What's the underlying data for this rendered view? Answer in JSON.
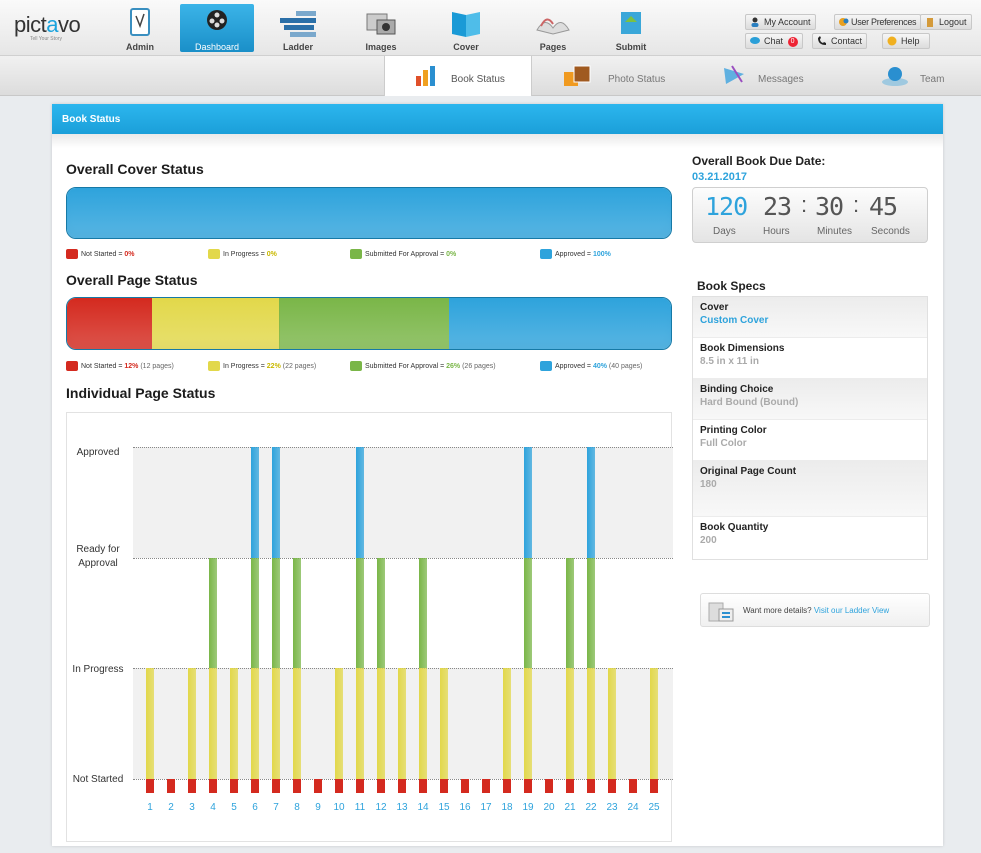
{
  "brand": {
    "name_pre": "pict",
    "name_o": "a",
    "name_post": "vo",
    "tagline": "Tell Your Story"
  },
  "nav": [
    {
      "label": "Admin",
      "icon": "clipboard-icon",
      "active": false
    },
    {
      "label": "Dashboard",
      "icon": "film-reel-icon",
      "active": true
    },
    {
      "label": "Ladder",
      "icon": "ladder-icon",
      "active": false
    },
    {
      "label": "Images",
      "icon": "images-icon",
      "active": false
    },
    {
      "label": "Cover",
      "icon": "book-cover-icon",
      "active": false
    },
    {
      "label": "Pages",
      "icon": "pages-icon",
      "active": false
    },
    {
      "label": "Submit",
      "icon": "submit-icon",
      "active": false
    }
  ],
  "account": {
    "my_account": "My Account",
    "user_preferences": "User Preferences",
    "logout": "Logout",
    "chat": "Chat",
    "chat_count": "0",
    "contact": "Contact",
    "help": "Help"
  },
  "subnav": [
    {
      "label": "Book Status",
      "icon": "bar-chart-icon",
      "active": true
    },
    {
      "label": "Photo Status",
      "icon": "photos-icon",
      "active": false
    },
    {
      "label": "Messages",
      "icon": "messages-icon",
      "active": false
    },
    {
      "label": "Team",
      "icon": "team-icon",
      "active": false
    }
  ],
  "panel": {
    "title": "Book Status"
  },
  "colors": {
    "not_started": "#d42a1f",
    "in_progress": "#e2d84a",
    "submitted": "#7ab648",
    "approved": "#2ea3dc"
  },
  "cover_status": {
    "title": "Overall Cover Status",
    "legend": [
      {
        "label": "Not Started = ",
        "pct": "0%",
        "pages": ""
      },
      {
        "label": "In Progress = ",
        "pct": "0%",
        "pages": ""
      },
      {
        "label": "Submitted For Approval = ",
        "pct": "0%",
        "pages": ""
      },
      {
        "label": "Approved = ",
        "pct": "100%",
        "pages": ""
      }
    ],
    "fractions": [
      0,
      0,
      0,
      1.0
    ]
  },
  "page_status": {
    "title": "Overall Page Status",
    "legend": [
      {
        "label": "Not Started = ",
        "pct": "12%",
        "pages": "(12 pages)"
      },
      {
        "label": "In Progress = ",
        "pct": "22%",
        "pages": "(22 pages)"
      },
      {
        "label": "Submitted For Approval = ",
        "pct": "26%",
        "pages": "(26 pages)"
      },
      {
        "label": "Approved = ",
        "pct": "40%",
        "pages": "(40 pages)"
      }
    ],
    "fractions": [
      0.14,
      0.21,
      0.28,
      0.37
    ]
  },
  "individual": {
    "title": "Individual Page Status",
    "levels": [
      "Not Started",
      "In Progress",
      "Ready for Approval",
      "Approved"
    ]
  },
  "chart_data": {
    "type": "bar",
    "title": "Individual Page Status",
    "categories": [
      "1",
      "2",
      "3",
      "4",
      "5",
      "6",
      "7",
      "8",
      "9",
      "10",
      "11",
      "12",
      "13",
      "14",
      "15",
      "16",
      "17",
      "18",
      "19",
      "20",
      "21",
      "22",
      "23",
      "24",
      "25"
    ],
    "values": [
      1,
      0,
      1,
      2,
      1,
      3,
      3,
      2,
      0,
      1,
      3,
      2,
      1,
      2,
      1,
      0,
      0,
      1,
      3,
      0,
      2,
      3,
      1,
      0,
      1
    ],
    "y_categories": [
      "Not Started",
      "In Progress",
      "Ready for Approval",
      "Approved"
    ],
    "xlabel": "",
    "ylabel": ""
  },
  "due": {
    "title": "Overall Book Due Date:",
    "date": "03.21.2017",
    "days": "120",
    "hours": "23",
    "minutes": "30",
    "seconds": "45",
    "days_label": "Days",
    "hours_label": "Hours",
    "minutes_label": "Minutes",
    "seconds_label": "Seconds"
  },
  "specs": {
    "title": "Book Specs",
    "items": [
      {
        "key": "Cover",
        "value": "Custom Cover"
      },
      {
        "key": "Book Dimensions",
        "value": "8.5 in x 11 in"
      },
      {
        "key": "Binding Choice",
        "value": "Hard Bound (Bound)"
      },
      {
        "key": "Printing Color",
        "value": "Full Color"
      },
      {
        "key": "Original Page Count",
        "value": "180"
      },
      {
        "key": "Book Quantity",
        "value": "200"
      }
    ]
  },
  "ladder_link": {
    "text": "Want more details?",
    "link": "Visit our Ladder View"
  }
}
